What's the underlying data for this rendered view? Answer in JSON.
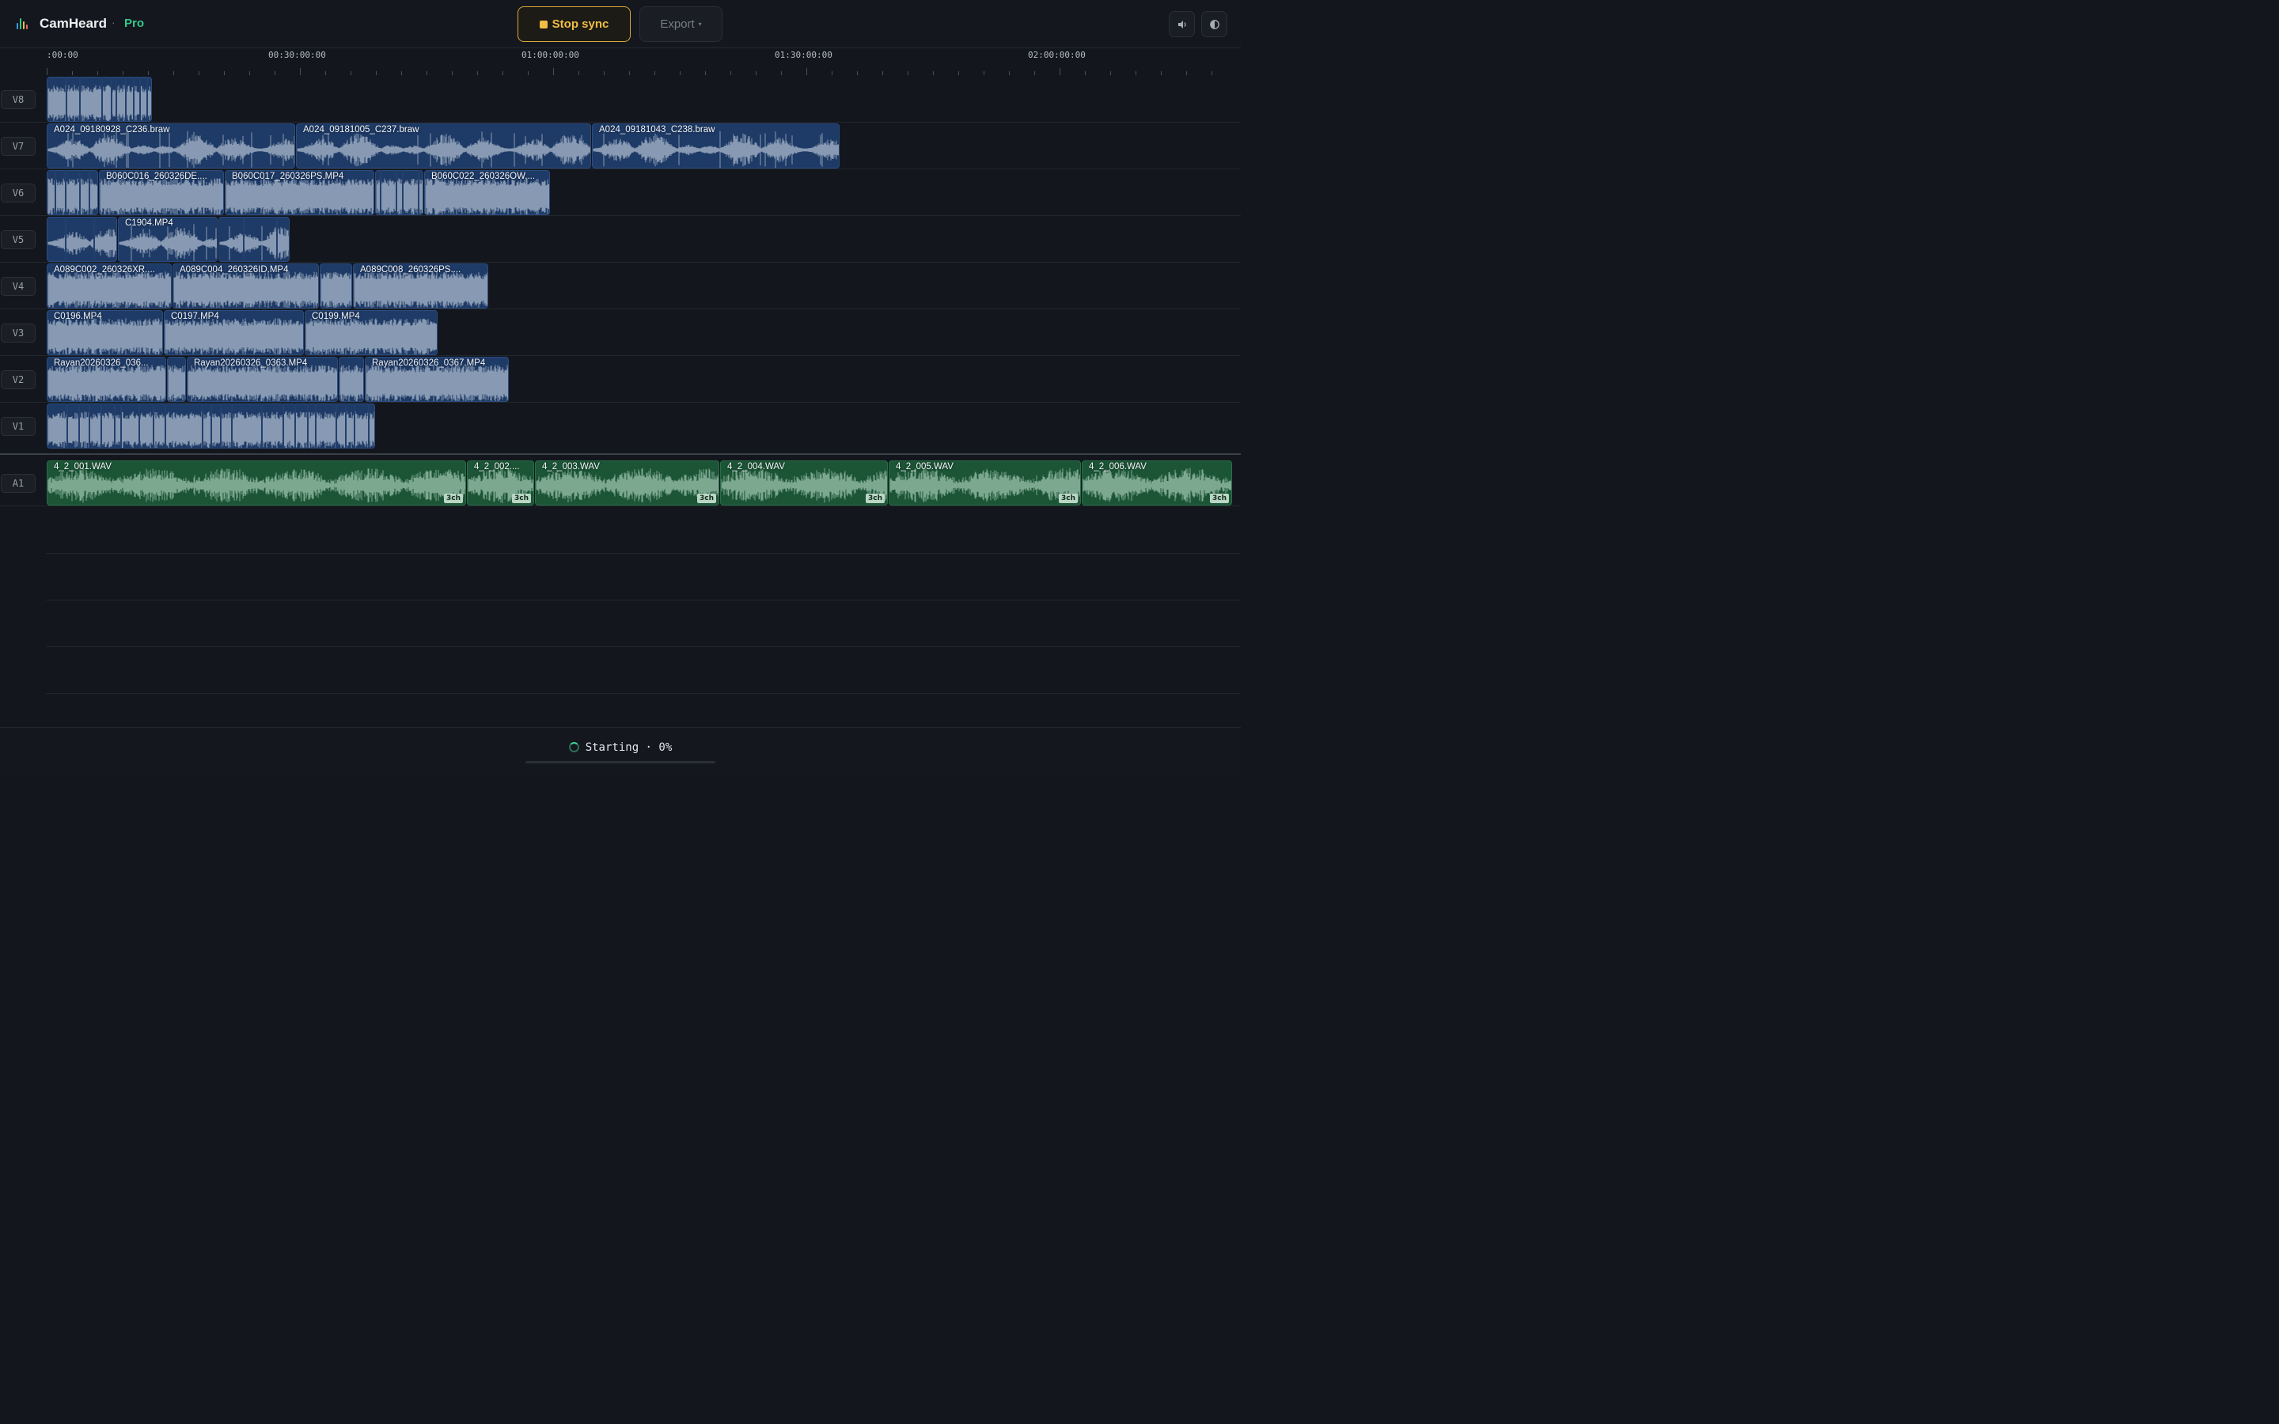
{
  "app": {
    "name": "CamHeard",
    "separator": "·",
    "tier": "Pro"
  },
  "toolbar": {
    "stop_sync_label": "Stop sync",
    "export_label": "Export",
    "export_caret": "▾",
    "volume_icon": "volume-icon",
    "theme_icon": "theme-toggle-icon"
  },
  "ruler": {
    "labels": [
      ":00:00",
      "00:30:00:00",
      "01:00:00:00",
      "01:30:00:00",
      "02:00:00:00"
    ]
  },
  "colors": {
    "accent": "#f0bd45",
    "pro": "#34c98b",
    "video_clip": "#1e3a66",
    "audio_clip": "#1c5536",
    "waveform": "#8fa0b8"
  },
  "tracks": [
    {
      "id": "V8",
      "clips": [
        {
          "label": ""
        }
      ]
    },
    {
      "id": "V7",
      "clips": [
        {
          "label": "A024_09180928_C236.braw"
        },
        {
          "label": "A024_09181005_C237.braw"
        },
        {
          "label": "A024_09181043_C238.braw"
        }
      ]
    },
    {
      "id": "V6",
      "clips": [
        {
          "label": ""
        },
        {
          "label": "B060C016_260326DE...."
        },
        {
          "label": "B060C017_260326PS.MP4"
        },
        {
          "label": ""
        },
        {
          "label": "B060C022_260326OW...."
        }
      ]
    },
    {
      "id": "V5",
      "clips": [
        {
          "label": ""
        },
        {
          "label": "C1904.MP4"
        },
        {
          "label": ""
        }
      ]
    },
    {
      "id": "V4",
      "clips": [
        {
          "label": "A089C002_260326XR...."
        },
        {
          "label": "A089C004_260326ID.MP4"
        },
        {
          "label": ""
        },
        {
          "label": "A089C008_260326PS...."
        }
      ]
    },
    {
      "id": "V3",
      "clips": [
        {
          "label": "C0196.MP4"
        },
        {
          "label": "C0197.MP4"
        },
        {
          "label": "C0199.MP4"
        }
      ]
    },
    {
      "id": "V2",
      "clips": [
        {
          "label": "Rayan20260326_036..."
        },
        {
          "label": ""
        },
        {
          "label": "Rayan20260326_0363.MP4"
        },
        {
          "label": ""
        },
        {
          "label": "Rayan20260326_0367.MP4"
        }
      ]
    },
    {
      "id": "V1",
      "clips": [
        {
          "label": ""
        }
      ]
    },
    {
      "id": "A1",
      "clips": [
        {
          "label": "4_2_001.WAV",
          "channels": "3ch"
        },
        {
          "label": "4_2_002....",
          "channels": "3ch"
        },
        {
          "label": "4_2_003.WAV",
          "channels": "3ch"
        },
        {
          "label": "4_2_004.WAV",
          "channels": "3ch"
        },
        {
          "label": "4_2_005.WAV",
          "channels": "3ch"
        },
        {
          "label": "4_2_006.WAV",
          "channels": "3ch"
        }
      ]
    }
  ],
  "status": {
    "text": "Starting · 0%",
    "progress_fraction": 0
  }
}
